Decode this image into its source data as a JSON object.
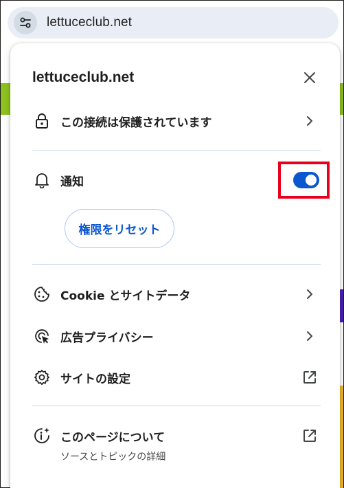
{
  "omnibox": {
    "url": "lettuceclub.net",
    "site_info_icon": "tune-icon"
  },
  "popup": {
    "title": "lettuceclub.net",
    "close_icon": "close-icon",
    "connection": {
      "label": "この接続は保護されています",
      "icon": "lock-icon"
    },
    "notifications": {
      "label": "通知",
      "icon": "bell-icon",
      "enabled": true
    },
    "reset_button": "権限をリセット",
    "cookies": {
      "label": "Cookie とサイトデータ",
      "icon": "cookie-icon"
    },
    "ad_privacy": {
      "label": "広告プライバシー",
      "icon": "ad-privacy-icon"
    },
    "site_settings": {
      "label": "サイトの設定",
      "icon": "gear-icon"
    },
    "about_page": {
      "label": "このページについて",
      "sublabel": "ソースとトピックの詳細",
      "icon": "info-sparkle-icon"
    }
  },
  "colors": {
    "accent": "#0b57d0",
    "highlight": "#e8001c",
    "omnibox_bg": "#e9eef6"
  }
}
